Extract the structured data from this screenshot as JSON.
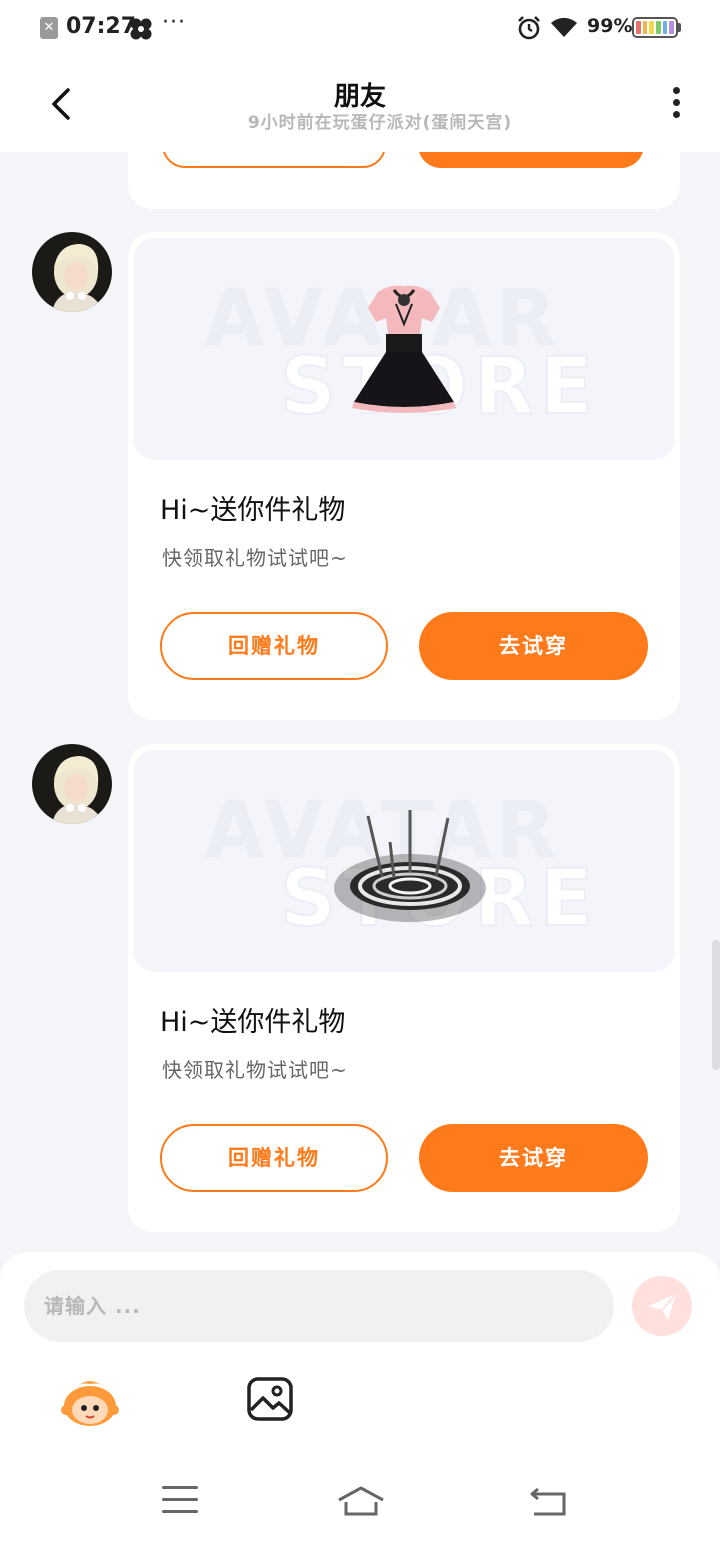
{
  "status_bar": {
    "time": "07:27",
    "dots": "···",
    "battery_percent": "99%"
  },
  "header": {
    "title": "朋友",
    "subtitle": "9小时前在玩蛋仔派对(蛋闹天宫)"
  },
  "watermark": {
    "line1": "AVATAR",
    "line2": "STORE"
  },
  "messages": [
    {
      "gift_item": "pink-black-dress-icon",
      "title": "Hi~送你件礼物",
      "desc": "快领取礼物试试吧~",
      "return_label": "回赠礼物",
      "try_label": "去试穿"
    },
    {
      "gift_item": "silver-ring-effect-icon",
      "title": "Hi~送你件礼物",
      "desc": "快领取礼物试试吧~",
      "return_label": "回赠礼物",
      "try_label": "去试穿"
    }
  ],
  "input": {
    "placeholder": "请输入 ..."
  },
  "colors": {
    "accent": "#ff7a1a",
    "background": "#f3f5f9",
    "send_disabled": "#ffe0dc"
  }
}
